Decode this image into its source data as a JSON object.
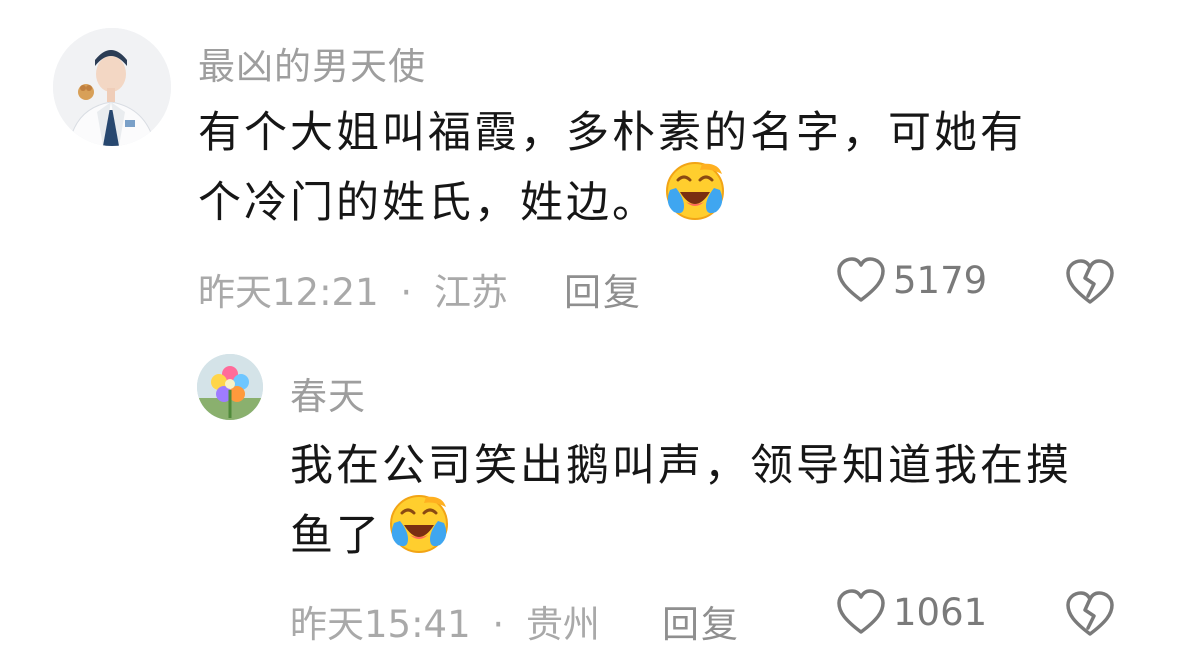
{
  "comments": [
    {
      "username": "最凶的男天使",
      "lines": [
        "有个大姐叫福霞，多朴素的名字，可她有",
        "个冷门的姓氏，姓边。"
      ],
      "emoji_icon": "laughing-crying-emoji",
      "time": "昨天12:21",
      "separator": "·",
      "location": "江苏",
      "reply_label": "回复",
      "like_count": "5179"
    },
    {
      "username": "春天",
      "lines": [
        "我在公司笑出鹅叫声，领导知道我在摸",
        "鱼了"
      ],
      "emoji_icon": "laughing-crying-emoji",
      "time": "昨天15:41",
      "separator": "·",
      "location": "贵州",
      "reply_label": "回复",
      "like_count": "1061"
    }
  ],
  "colors": {
    "username": "#9e9e9e",
    "text": "#161616",
    "meta": "#a9a9a9",
    "icon": "#7a7a7a"
  }
}
